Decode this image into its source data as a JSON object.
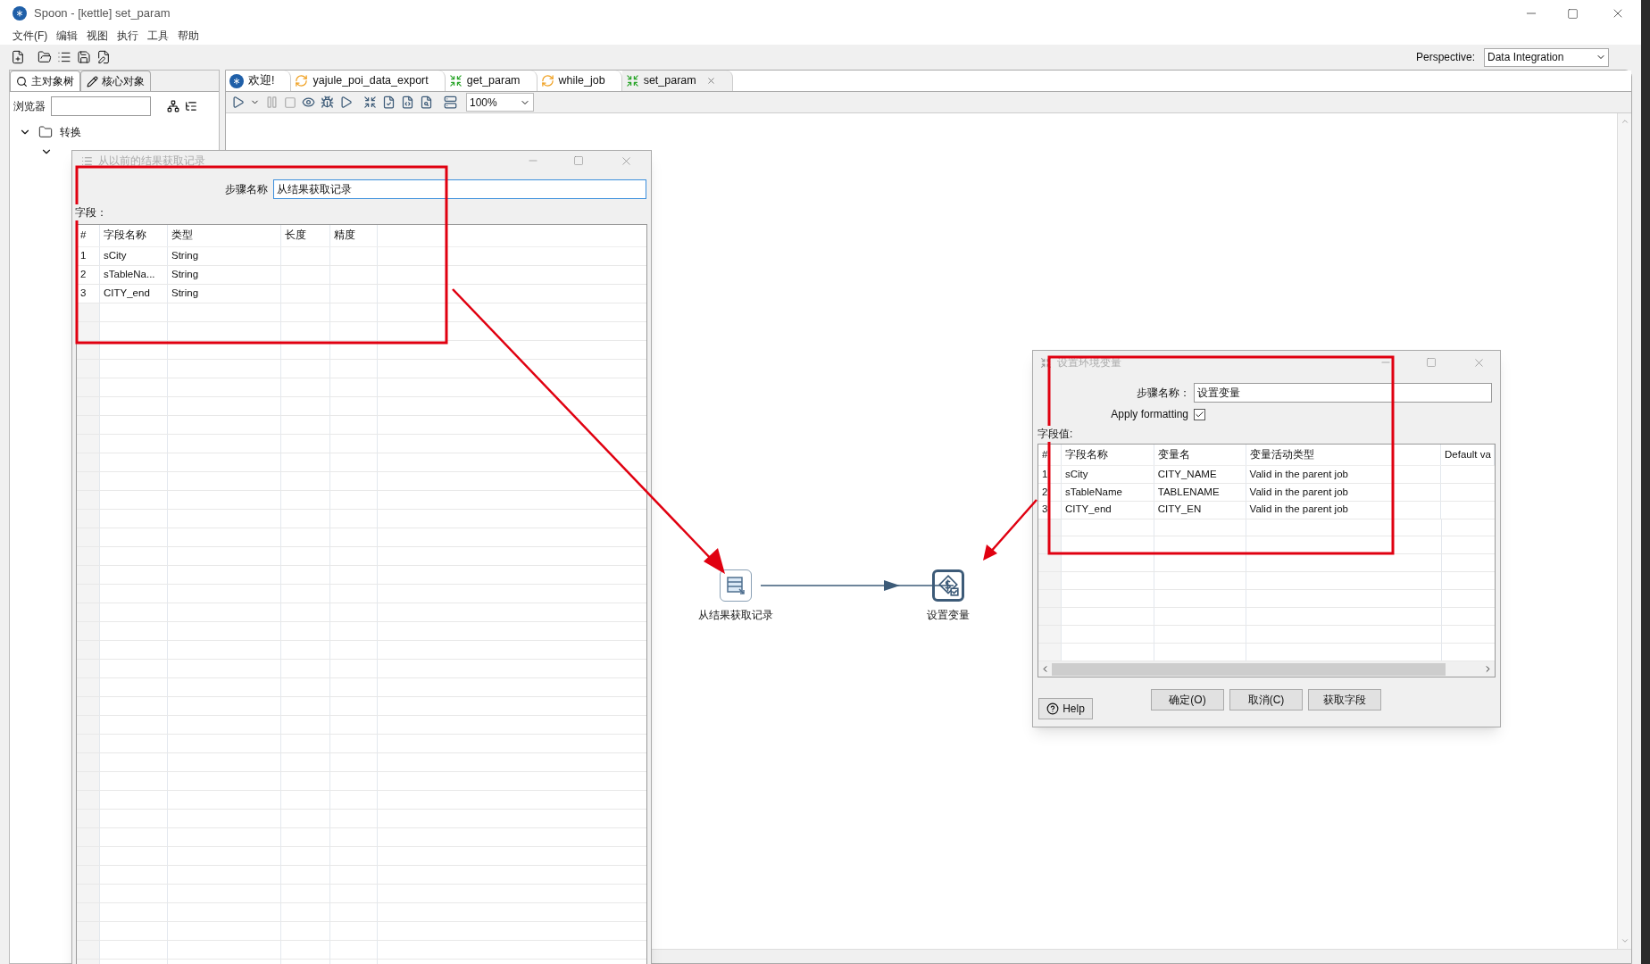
{
  "window": {
    "title": "Spoon - [kettle] set_param"
  },
  "menu": [
    "文件(F)",
    "编辑",
    "视图",
    "执行",
    "工具",
    "帮助"
  ],
  "perspective": {
    "label": "Perspective:",
    "value": "Data Integration"
  },
  "sidebar": {
    "tabs": [
      {
        "label": "主对象树",
        "selected": true
      },
      {
        "label": "核心对象",
        "selected": false
      }
    ],
    "search_label": "浏览器",
    "tree": [
      {
        "label": "转换",
        "expanded": true,
        "children": [
          {
            "expanded": true
          }
        ]
      }
    ]
  },
  "tabs": [
    {
      "label": "欢迎!",
      "kind": "welcome",
      "selected": false
    },
    {
      "label": "yajule_poi_data_export",
      "kind": "job",
      "selected": false
    },
    {
      "label": "get_param",
      "kind": "transformation",
      "selected": false
    },
    {
      "label": "while_job",
      "kind": "job",
      "selected": false
    },
    {
      "label": "set_param",
      "kind": "transformation",
      "selected": true
    }
  ],
  "zoom": "100%",
  "canvas": {
    "steps": [
      {
        "label": "从结果获取记录",
        "kind": "get-rows",
        "selected": false
      },
      {
        "label": "设置变量",
        "kind": "set-variables",
        "selected": true
      }
    ]
  },
  "rows_dialog": {
    "title": "从以前的结果获取记录",
    "step_name_label": "步骤名称",
    "step_name": "从结果获取记录",
    "fields_label": "字段：",
    "columns": [
      "#",
      "字段名称",
      "类型",
      "长度",
      "精度"
    ],
    "rows": [
      {
        "index": "1",
        "name": "sCity",
        "type": "String"
      },
      {
        "index": "2",
        "name": "sTableNa...",
        "type": "String"
      },
      {
        "index": "3",
        "name": "CITY_end",
        "type": "String"
      }
    ]
  },
  "variables_dialog": {
    "title": "设置环境变量",
    "step_name_label": "步骤名称：",
    "step_name": "设置变量",
    "apply_formatting": {
      "label": "Apply formatting",
      "checked": true
    },
    "fields_label": "字段值:",
    "columns": [
      "#",
      "字段名称",
      "变量名",
      "变量活动类型",
      "Default va"
    ],
    "rows": [
      {
        "index": "1",
        "field": "sCity",
        "variable": "CITY_NAME",
        "scope": "Valid in the parent job"
      },
      {
        "index": "2",
        "field": "sTableName",
        "variable": "TABLENAME",
        "scope": "Valid in the parent job"
      },
      {
        "index": "3",
        "field": "CITY_end",
        "variable": "CITY_EN",
        "scope": "Valid in the parent job"
      }
    ],
    "help": "Help",
    "buttons": [
      "确定(O)",
      "取消(C)",
      "获取字段"
    ]
  }
}
